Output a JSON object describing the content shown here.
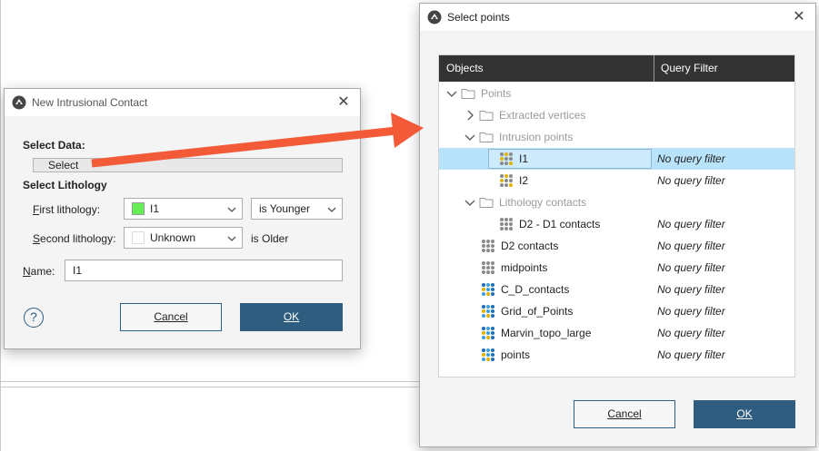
{
  "colors": {
    "primary_button": "#2e5d80",
    "selection": "#b8e3fb",
    "header": "#333333",
    "arrow": "#f25a38",
    "lithology_swatch": "#66ee55",
    "unknown_swatch": "#ffffff"
  },
  "contact_dialog": {
    "title": "New Intrusional Contact",
    "select_data_label": "Select Data:",
    "select_button": "Select",
    "select_lithology_label": "Select Lithology",
    "first_lithology_label": "First lithology:",
    "first_lithology_value": "I1",
    "first_relation": "is Younger",
    "second_lithology_label": "Second lithology:",
    "second_lithology_value": "Unknown",
    "second_relation": "is Older",
    "name_label": "Name:",
    "name_value": "I1",
    "help_icon_glyph": "?",
    "cancel": "Cancel",
    "ok": "OK"
  },
  "points_dialog": {
    "title": "Select points",
    "columns": {
      "objects": "Objects",
      "filter": "Query Filter"
    },
    "tree": [
      {
        "name": "Points",
        "icon": "folder-icon",
        "caret": "down",
        "filter": ""
      },
      {
        "name": "Extracted vertices",
        "icon": "folder-icon",
        "caret": "right",
        "filter": ""
      },
      {
        "name": "Intrusion points",
        "icon": "folder-icon",
        "caret": "down",
        "filter": ""
      },
      {
        "name": "I1",
        "icon": "points-icon",
        "caret": "",
        "filter": "No query filter"
      },
      {
        "name": "I2",
        "icon": "points-icon",
        "caret": "",
        "filter": "No query filter"
      },
      {
        "name": "Lithology contacts",
        "icon": "folder-icon",
        "caret": "down",
        "filter": ""
      },
      {
        "name": "D2 - D1 contacts",
        "icon": "points-icon",
        "caret": "",
        "filter": "No query filter"
      },
      {
        "name": "D2 contacts",
        "icon": "points-icon",
        "caret": "",
        "filter": "No query filter"
      },
      {
        "name": "midpoints",
        "icon": "points-icon",
        "caret": "",
        "filter": "No query filter"
      },
      {
        "name": "C_D_contacts",
        "icon": "points-icon",
        "caret": "",
        "filter": "No query filter"
      },
      {
        "name": "Grid_of_Points",
        "icon": "points-icon",
        "caret": "",
        "filter": "No query filter"
      },
      {
        "name": "Marvin_topo_large",
        "icon": "points-icon",
        "caret": "",
        "filter": "No query filter"
      },
      {
        "name": "points",
        "icon": "points-icon",
        "caret": "",
        "filter": "No query filter"
      }
    ],
    "cancel": "Cancel",
    "ok": "OK"
  }
}
